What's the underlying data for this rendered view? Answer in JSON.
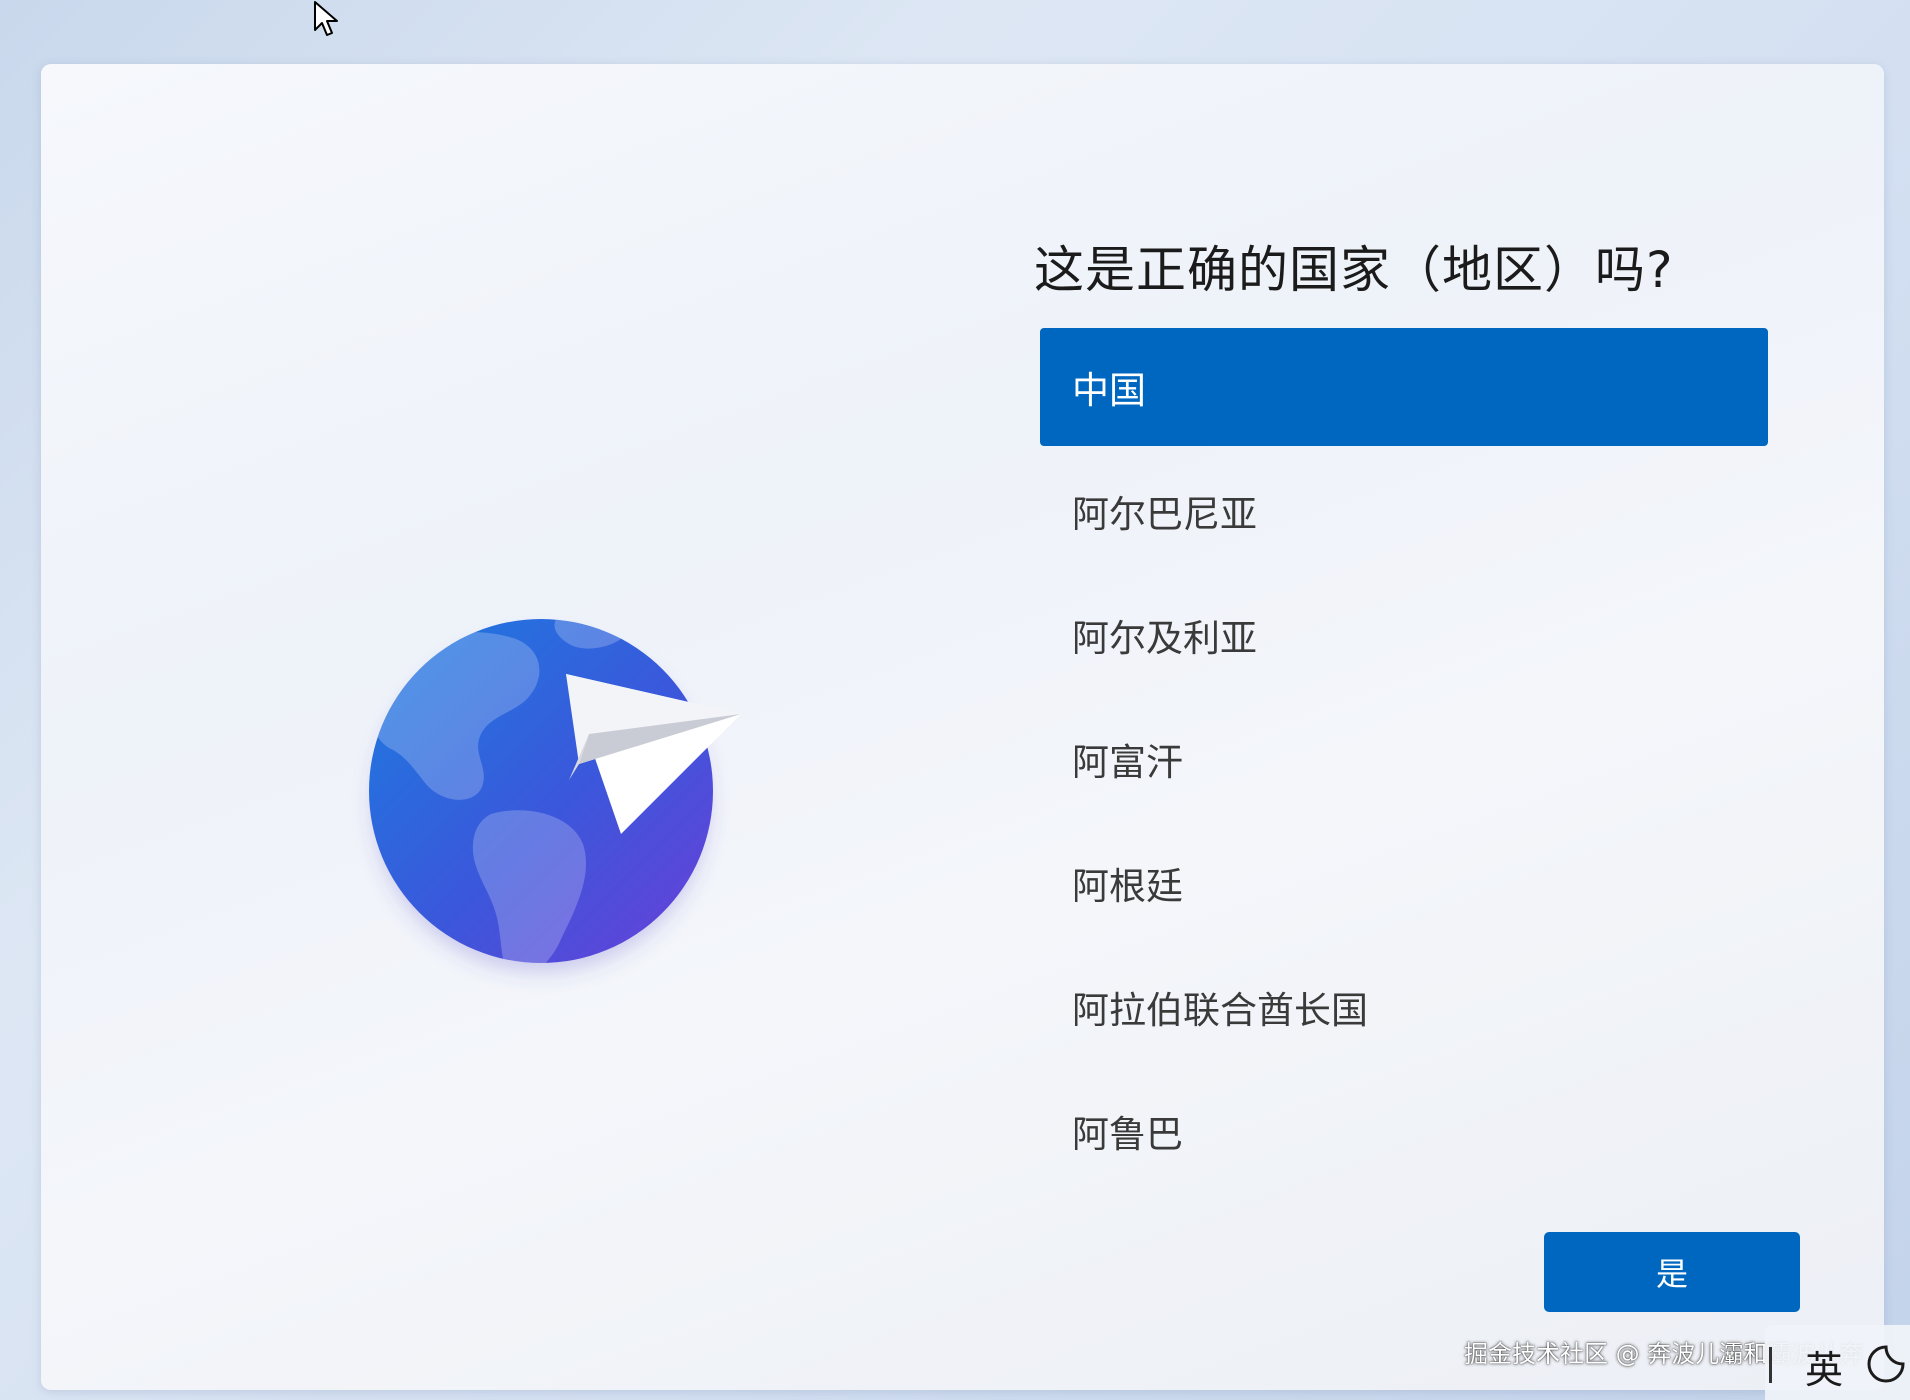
{
  "oobe": {
    "title": "这是正确的国家（地区）吗?",
    "selected_index": 0,
    "regions": [
      {
        "label": "中国",
        "selected": true
      },
      {
        "label": "阿尔巴尼亚",
        "selected": false
      },
      {
        "label": "阿尔及利亚",
        "selected": false
      },
      {
        "label": "阿富汗",
        "selected": false
      },
      {
        "label": "阿根廷",
        "selected": false
      },
      {
        "label": "阿拉伯联合酋长国",
        "selected": false
      },
      {
        "label": "阿鲁巴",
        "selected": false
      }
    ],
    "yes_button_label": "是"
  },
  "watermark": "掘金技术社区 @ 奔波儿灞和灞波儿奔",
  "tray": {
    "ime_indicator": "英"
  },
  "colors": {
    "accent": "#0067c0",
    "text": "#1b1b1b",
    "list_text": "#3a3a3a"
  },
  "icons": {
    "illustration": "globe-with-paper-plane",
    "cursor": "mouse-pointer-arrow"
  }
}
